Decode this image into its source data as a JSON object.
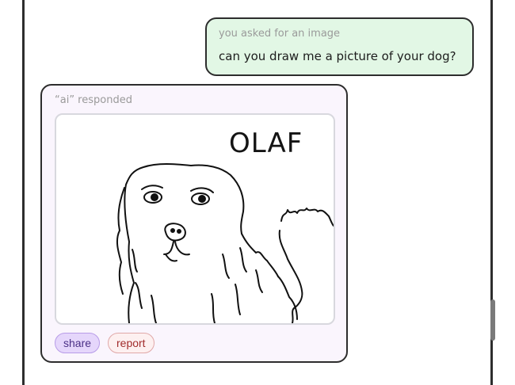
{
  "conversation": {
    "user_message": {
      "caption": "you asked for an image",
      "text": "can you draw me a picture of your dog?"
    },
    "ai_message": {
      "caption": "“ai” responded",
      "image": {
        "subject": "hand-drawn-dog-icon",
        "handwritten_text": "OLAF"
      },
      "actions": {
        "share_label": "share",
        "report_label": "report"
      }
    }
  },
  "colors": {
    "user_bubble_bg": "#e2f7e5",
    "ai_bubble_bg": "#faf5fd",
    "share_bg": "#e5d6fb",
    "report_bg": "#fdf0f0",
    "border": "#2d2d2d"
  }
}
